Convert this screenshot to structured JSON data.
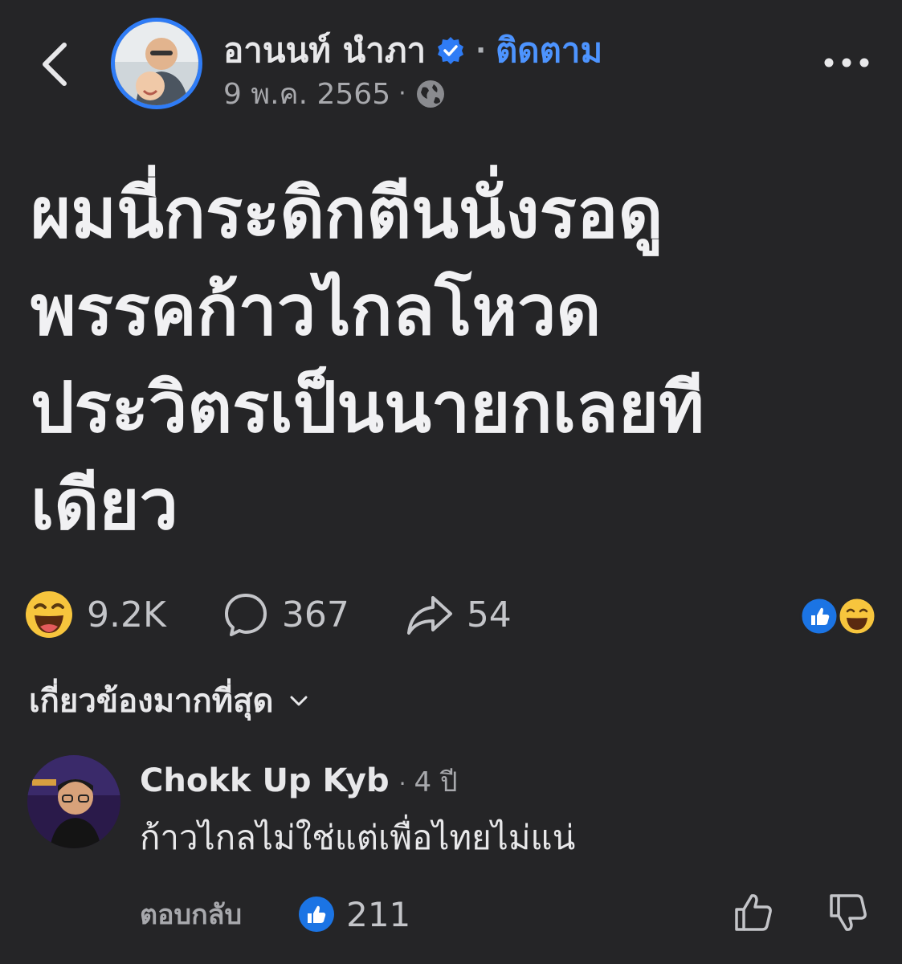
{
  "header": {
    "back_icon": "chevron-left-icon",
    "author": "อานนท์ นำภา",
    "verified_icon": "verified-badge-icon",
    "separator": "·",
    "follow_label": "ติดตาม",
    "date": "9 พ.ค. 2565",
    "privacy_icon": "globe-icon",
    "more_icon": "more-dots-icon"
  },
  "post": {
    "lines": [
      "ผมนี่กระดิกตีนนั่งรอดู",
      "พรรคก้าวไกลโหวด",
      "ประวิตรเป็นนายกเลยที",
      "เดียว"
    ]
  },
  "stats": {
    "reactions": "9.2K",
    "comments": "367",
    "shares": "54"
  },
  "sort": {
    "label": "เกี่ยวข้องมากที่สุด"
  },
  "comment": {
    "name": "Chokk Up Kyb",
    "separator": "·",
    "time": "4 ปี",
    "text": "ก้าวไกลไม่ใช่แต่เพื่อไทยไม่แน่",
    "reply_label": "ตอบกลับ",
    "likes": "211"
  },
  "colors": {
    "background": "#252527",
    "accent": "#2f7cf6",
    "follow": "#4d94ff"
  }
}
